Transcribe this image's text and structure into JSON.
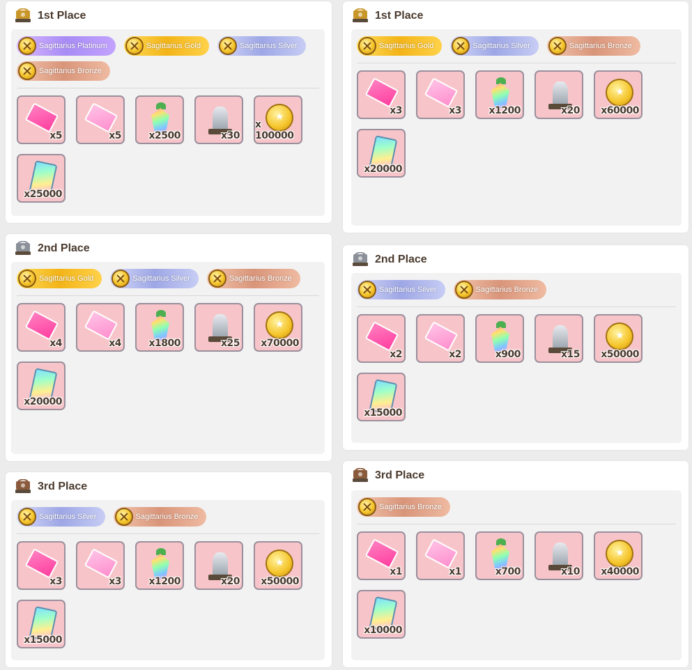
{
  "left": [
    {
      "place": "1st Place",
      "trophy": "gold-trophy-icon",
      "badges": [
        {
          "label": "Sagittarius Platinum",
          "tier": "platinum"
        },
        {
          "label": "Sagittarius Gold",
          "tier": "gold"
        },
        {
          "label": "Sagittarius Silver",
          "tier": "silver"
        },
        {
          "label": "Sagittarius Bronze",
          "tier": "bronze"
        }
      ],
      "items": [
        {
          "icon": "pink-ticket-icon",
          "count": "x5"
        },
        {
          "icon": "pink-ticket-alt-icon",
          "count": "x5"
        },
        {
          "icon": "rainbow-carrot-icon",
          "count": "x2500"
        },
        {
          "icon": "horse-statue-icon",
          "count": "x30"
        },
        {
          "icon": "gold-coin-icon",
          "count": "x 100000"
        },
        {
          "icon": "rainbow-card-icon",
          "count": "x25000"
        }
      ]
    },
    {
      "place": "2nd Place",
      "trophy": "silver-trophy-icon",
      "badges": [
        {
          "label": "Sagittarius Gold",
          "tier": "gold"
        },
        {
          "label": "Sagittarius Silver",
          "tier": "silver"
        },
        {
          "label": "Sagittarius Bronze",
          "tier": "bronze"
        }
      ],
      "items": [
        {
          "icon": "pink-ticket-icon",
          "count": "x4"
        },
        {
          "icon": "pink-ticket-alt-icon",
          "count": "x4"
        },
        {
          "icon": "rainbow-carrot-icon",
          "count": "x1800"
        },
        {
          "icon": "horse-statue-icon",
          "count": "x25"
        },
        {
          "icon": "gold-coin-icon",
          "count": "x70000"
        },
        {
          "icon": "rainbow-card-icon",
          "count": "x20000"
        }
      ]
    },
    {
      "place": "3rd Place",
      "trophy": "bronze-trophy-icon",
      "badges": [
        {
          "label": "Sagittarius Silver",
          "tier": "silver"
        },
        {
          "label": "Sagittarius Bronze",
          "tier": "bronze"
        }
      ],
      "items": [
        {
          "icon": "pink-ticket-icon",
          "count": "x3"
        },
        {
          "icon": "pink-ticket-alt-icon",
          "count": "x3"
        },
        {
          "icon": "rainbow-carrot-icon",
          "count": "x1200"
        },
        {
          "icon": "horse-statue-icon",
          "count": "x20"
        },
        {
          "icon": "gold-coin-icon",
          "count": "x50000"
        },
        {
          "icon": "rainbow-card-icon",
          "count": "x15000"
        }
      ]
    }
  ],
  "right": [
    {
      "place": "1st Place",
      "trophy": "gold-trophy-icon",
      "badges": [
        {
          "label": "Sagittarius Gold",
          "tier": "gold"
        },
        {
          "label": "Sagittarius Silver",
          "tier": "silver"
        },
        {
          "label": "Sagittarius Bronze",
          "tier": "bronze"
        }
      ],
      "items": [
        {
          "icon": "pink-ticket-icon",
          "count": "x3"
        },
        {
          "icon": "pink-ticket-alt-icon",
          "count": "x3"
        },
        {
          "icon": "rainbow-carrot-icon",
          "count": "x1200"
        },
        {
          "icon": "horse-statue-icon",
          "count": "x20"
        },
        {
          "icon": "gold-coin-icon",
          "count": "x60000"
        },
        {
          "icon": "rainbow-card-icon",
          "count": "x20000"
        }
      ]
    },
    {
      "place": "2nd Place",
      "trophy": "silver-trophy-icon",
      "badges": [
        {
          "label": "Sagittarius Silver",
          "tier": "silver"
        },
        {
          "label": "Sagittarius Bronze",
          "tier": "bronze"
        }
      ],
      "items": [
        {
          "icon": "pink-ticket-icon",
          "count": "x2"
        },
        {
          "icon": "pink-ticket-alt-icon",
          "count": "x2"
        },
        {
          "icon": "rainbow-carrot-icon",
          "count": "x900"
        },
        {
          "icon": "horse-statue-icon",
          "count": "x15"
        },
        {
          "icon": "gold-coin-icon",
          "count": "x50000"
        },
        {
          "icon": "rainbow-card-icon",
          "count": "x15000"
        }
      ]
    },
    {
      "place": "3rd Place",
      "trophy": "bronze-trophy-icon",
      "badges": [
        {
          "label": "Sagittarius Bronze",
          "tier": "bronze"
        }
      ],
      "items": [
        {
          "icon": "pink-ticket-icon",
          "count": "x1"
        },
        {
          "icon": "pink-ticket-alt-icon",
          "count": "x1"
        },
        {
          "icon": "rainbow-carrot-icon",
          "count": "x700"
        },
        {
          "icon": "horse-statue-icon",
          "count": "x10"
        },
        {
          "icon": "gold-coin-icon",
          "count": "x40000"
        },
        {
          "icon": "rainbow-card-icon",
          "count": "x10000"
        }
      ]
    }
  ],
  "colors": {
    "gold_trophy": "#c9962a",
    "silver_trophy": "#8a8f98",
    "bronze_trophy": "#8a5a3c"
  }
}
